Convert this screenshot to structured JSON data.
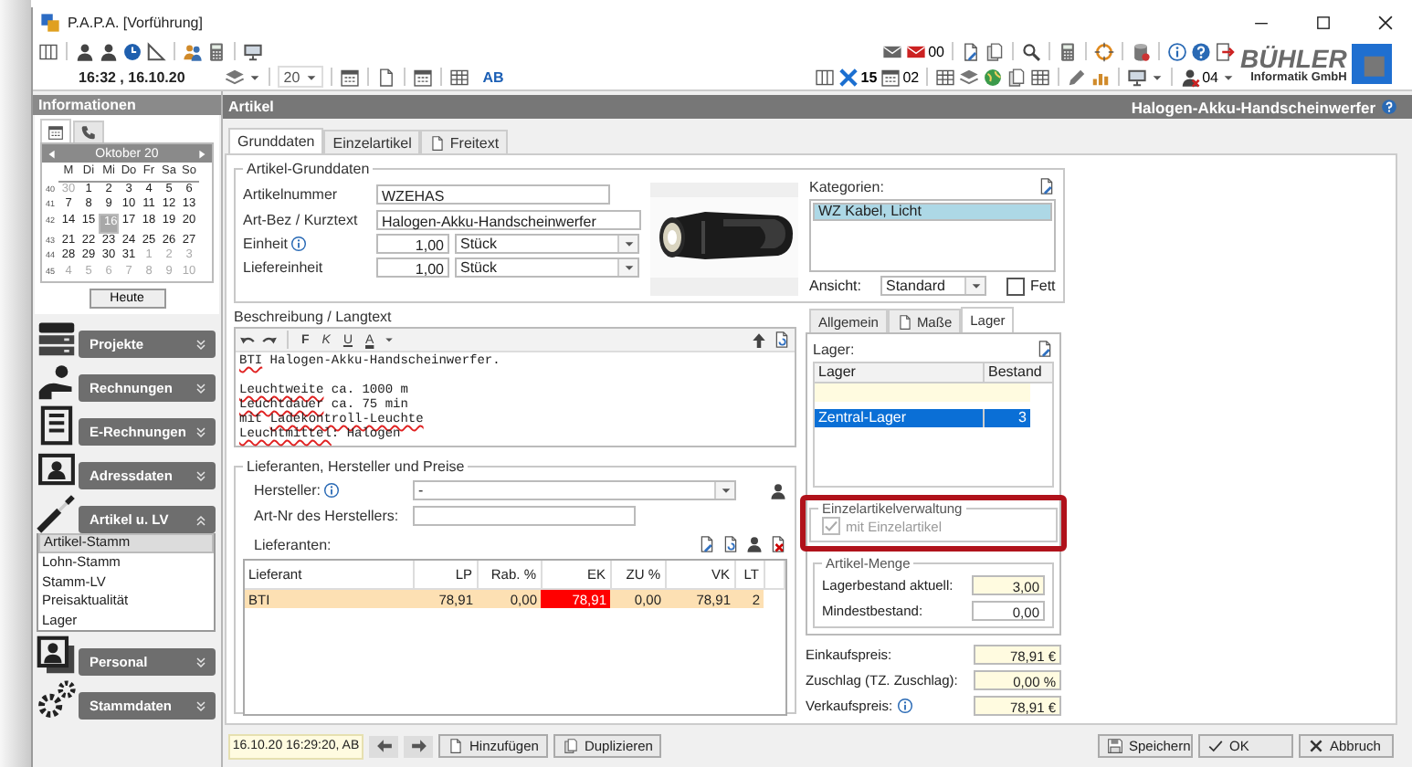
{
  "window": {
    "title": "P.A.P.A. [Vorführung]"
  },
  "toolbar": {
    "mail_count": "00",
    "time": "16:32 , 16.10.20",
    "year": "20",
    "initials": "AB",
    "task_count": "15",
    "doc_count": "02",
    "user_count": "04"
  },
  "logo": {
    "name": "BÜHLER",
    "subtitle": "Informatik GmbH"
  },
  "sidebar": {
    "title": "Informationen",
    "tabs": [
      {
        "kind": "calendar",
        "selected": true
      },
      {
        "kind": "phone",
        "selected": false
      }
    ],
    "calendar": {
      "month": "Oktober 20",
      "weekdays": [
        "M",
        "Di",
        "Mi",
        "Do",
        "Fr",
        "Sa",
        "So"
      ],
      "weeks": [
        {
          "number": "40",
          "days": [
            {
              "day": "30",
              "muted": true,
              "selected": false
            },
            {
              "day": "1",
              "muted": false,
              "selected": false
            },
            {
              "day": "2",
              "muted": false,
              "selected": false
            },
            {
              "day": "3",
              "muted": false,
              "selected": false
            },
            {
              "day": "4",
              "muted": false,
              "selected": false
            },
            {
              "day": "5",
              "muted": false,
              "selected": false
            },
            {
              "day": "6",
              "muted": false,
              "selected": false
            }
          ]
        },
        {
          "number": "41",
          "days": [
            {
              "day": "7",
              "muted": false,
              "selected": false
            },
            {
              "day": "8",
              "muted": false,
              "selected": false
            },
            {
              "day": "9",
              "muted": false,
              "selected": false
            },
            {
              "day": "10",
              "muted": false,
              "selected": false
            },
            {
              "day": "11",
              "muted": false,
              "selected": false
            },
            {
              "day": "12",
              "muted": false,
              "selected": false
            },
            {
              "day": "13",
              "muted": false,
              "selected": false
            }
          ]
        },
        {
          "number": "42",
          "days": [
            {
              "day": "14",
              "muted": false,
              "selected": false
            },
            {
              "day": "15",
              "muted": false,
              "selected": false
            },
            {
              "day": "16",
              "muted": false,
              "selected": true
            },
            {
              "day": "17",
              "muted": false,
              "selected": false
            },
            {
              "day": "18",
              "muted": false,
              "selected": false
            },
            {
              "day": "19",
              "muted": false,
              "selected": false
            },
            {
              "day": "20",
              "muted": false,
              "selected": false
            }
          ]
        },
        {
          "number": "43",
          "days": [
            {
              "day": "21",
              "muted": false,
              "selected": false
            },
            {
              "day": "22",
              "muted": false,
              "selected": false
            },
            {
              "day": "23",
              "muted": false,
              "selected": false
            },
            {
              "day": "24",
              "muted": false,
              "selected": false
            },
            {
              "day": "25",
              "muted": false,
              "selected": false
            },
            {
              "day": "26",
              "muted": false,
              "selected": false
            },
            {
              "day": "27",
              "muted": false,
              "selected": false
            }
          ]
        },
        {
          "number": "44",
          "days": [
            {
              "day": "28",
              "muted": false,
              "selected": false
            },
            {
              "day": "29",
              "muted": false,
              "selected": false
            },
            {
              "day": "30",
              "muted": false,
              "selected": false
            },
            {
              "day": "31",
              "muted": false,
              "selected": false
            },
            {
              "day": "1",
              "muted": true,
              "selected": false
            },
            {
              "day": "2",
              "muted": true,
              "selected": false
            },
            {
              "day": "3",
              "muted": true,
              "selected": false
            }
          ]
        },
        {
          "number": "45",
          "days": [
            {
              "day": "4",
              "muted": true,
              "selected": false
            },
            {
              "day": "5",
              "muted": true,
              "selected": false
            },
            {
              "day": "6",
              "muted": true,
              "selected": false
            },
            {
              "day": "7",
              "muted": true,
              "selected": false
            },
            {
              "day": "8",
              "muted": true,
              "selected": false
            },
            {
              "day": "9",
              "muted": true,
              "selected": false
            },
            {
              "day": "10",
              "muted": true,
              "selected": false
            }
          ]
        }
      ]
    },
    "today_button": "Heute",
    "groups": [
      {
        "label": "Projekte",
        "kind": "projects",
        "expanded": false
      },
      {
        "label": "Rechnungen",
        "kind": "invoices",
        "expanded": false
      },
      {
        "label": "E-Rechnungen",
        "kind": "e-invoices",
        "expanded": false
      },
      {
        "label": "Adressdaten",
        "kind": "addresses",
        "expanded": false
      },
      {
        "label": "Artikel u. LV",
        "kind": "articles",
        "expanded": true,
        "items": [
          {
            "label": "Artikel-Stamm",
            "selected": true
          },
          {
            "label": "Lohn-Stamm",
            "selected": false
          },
          {
            "label": "Stamm-LV",
            "selected": false
          },
          {
            "label": "Preisaktualität",
            "selected": false
          },
          {
            "label": "Lager",
            "selected": false
          }
        ]
      },
      {
        "label": "Personal",
        "kind": "staff",
        "expanded": false
      },
      {
        "label": "Stammdaten",
        "kind": "master",
        "expanded": false
      }
    ]
  },
  "article": {
    "header": "Artikel",
    "title": "Halogen-Akku-Handscheinwerfer",
    "tabs": [
      {
        "label": "Grunddaten",
        "kind": "plain",
        "selected": true
      },
      {
        "label": "Einzelartikel",
        "kind": "plain",
        "selected": false
      },
      {
        "label": "Freitext",
        "kind": "document",
        "selected": false
      }
    ],
    "basic": {
      "title": "Artikel-Grunddaten",
      "number_label": "Artikelnummer",
      "number": "WZEHAS",
      "name_label": "Art-Bez / Kurztext",
      "name": "Halogen-Akku-Handscheinwerfer",
      "units": [
        {
          "label": "Einheit",
          "info": true,
          "quantity": "1,00",
          "unit": "Stück"
        },
        {
          "label": "Liefereinheit",
          "info": false,
          "quantity": "1,00",
          "unit": "Stück"
        }
      ],
      "categories_label": "Kategorien:",
      "categories": [
        {
          "label": "WZ Kabel, Licht",
          "selected": true
        }
      ],
      "view_label": "Ansicht:",
      "view": "Standard",
      "bold": {
        "label": "Fett",
        "checked": false
      }
    },
    "description": {
      "label": "Beschreibung / Langtext",
      "format_buttons": [
        "F",
        "K",
        "U",
        "A"
      ],
      "paragraphs": [
        {
          "lines": [
            [
              {
                "text": "BTI",
                "misspelled": true
              },
              {
                "text": " Halogen-Akku-Handscheinwerfer.",
                "misspelled": false
              }
            ]
          ]
        },
        {
          "lines": [
            [
              {
                "text": "Leuchtweite",
                "misspelled": true
              },
              {
                "text": " ca. 1000 m",
                "misspelled": false
              }
            ],
            [
              {
                "text": "Leuchtdauer",
                "misspelled": true
              },
              {
                "text": " ca. 75 min",
                "misspelled": false
              }
            ],
            [
              {
                "text": "mit ",
                "misspelled": false
              },
              {
                "text": "Ladekontroll-Leuchte",
                "misspelled": true
              }
            ],
            [
              {
                "text": "Leuchtmittel",
                "misspelled": true
              },
              {
                "text": ": Halogen",
                "misspelled": false
              }
            ]
          ]
        }
      ]
    },
    "suppliers": {
      "title": "Lieferanten, Hersteller und Preise",
      "maker_label": "Hersteller:",
      "maker": "-",
      "maker_number_label": "Art-Nr des Herstellers:",
      "list_label": "Lieferanten:",
      "columns": [
        "Lieferant",
        "LP",
        "Rab. %",
        "EK",
        "ZU %",
        "VK",
        "LT"
      ],
      "rows": [
        {
          "selected": true,
          "cells": [
            {
              "text": "BTI",
              "alert": false
            },
            {
              "text": "78,91",
              "alert": false
            },
            {
              "text": "0,00",
              "alert": false
            },
            {
              "text": "78,91",
              "alert": true
            },
            {
              "text": "0,00",
              "alert": false
            },
            {
              "text": "78,91",
              "alert": false
            },
            {
              "text": "2",
              "alert": false
            }
          ]
        }
      ]
    },
    "detail_tabs": [
      {
        "label": "Allgemein",
        "kind": "plain",
        "selected": false
      },
      {
        "label": "Maße",
        "kind": "document",
        "selected": false
      },
      {
        "label": "Lager",
        "kind": "plain",
        "selected": true
      }
    ],
    "stock": {
      "label": "Lager:",
      "columns": [
        "Lager",
        "Bestand"
      ],
      "rows": [
        {
          "kind": "new",
          "selected": false
        },
        {
          "kind": "entry",
          "name": "Zentral-Lager",
          "quantity": "3",
          "selected": true
        }
      ]
    },
    "single_items": {
      "title": "Einzelartikelverwaltung",
      "highlighted": true,
      "checkbox": {
        "label": "mit Einzelartikel",
        "checked": true,
        "disabled": true
      }
    },
    "quantity": {
      "title": "Artikel-Menge",
      "fields": [
        {
          "label": "Lagerbestand aktuell:",
          "value": "3,00",
          "kind": "readonly"
        },
        {
          "label": "Mindestbestand:",
          "value": "0,00",
          "kind": "editable"
        }
      ]
    },
    "prices": [
      {
        "label": "Einkaufspreis:",
        "info": false,
        "value": "78,91 €"
      },
      {
        "label": "Zuschlag (TZ. Zuschlag):",
        "info": false,
        "value": "0,00 %"
      },
      {
        "label": "Verkaufspreis:",
        "info": true,
        "value": "78,91 €"
      }
    ]
  },
  "footer": {
    "stamp": "16.10.20 16:29:20, AB",
    "left_buttons": [
      {
        "label": "Hinzufügen",
        "kind": "add"
      },
      {
        "label": "Duplizieren",
        "kind": "duplicate"
      }
    ],
    "right_buttons": [
      {
        "label": "Speichern",
        "kind": "save"
      },
      {
        "label": "OK",
        "kind": "ok"
      },
      {
        "label": "Abbruch",
        "kind": "cancel"
      }
    ]
  }
}
